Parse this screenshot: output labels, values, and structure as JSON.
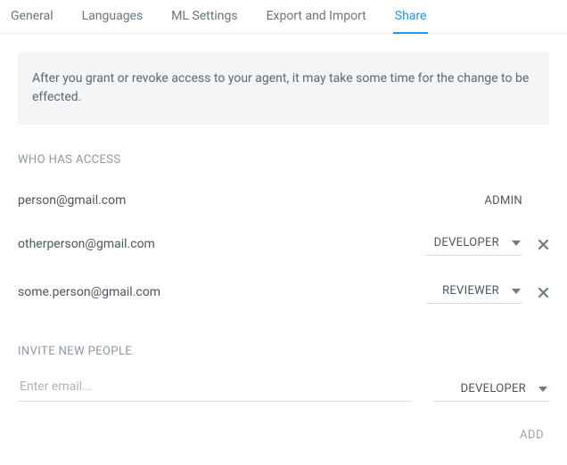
{
  "tabs": [
    {
      "label": "General",
      "active": false
    },
    {
      "label": "Languages",
      "active": false
    },
    {
      "label": "ML Settings",
      "active": false
    },
    {
      "label": "Export and Import",
      "active": false
    },
    {
      "label": "Share",
      "active": true
    }
  ],
  "notice": "After you grant or revoke access to your agent, it may take some time for the change to be effected.",
  "sections": {
    "access_heading": "WHO HAS ACCESS",
    "invite_heading": "INVITE NEW PEOPLE"
  },
  "access": [
    {
      "email": "person@gmail.com",
      "role": "ADMIN",
      "editable": false,
      "removable": false
    },
    {
      "email": "otherperson@gmail.com",
      "role": "DEVELOPER",
      "editable": true,
      "removable": true
    },
    {
      "email": "some.person@gmail.com",
      "role": "REVIEWER",
      "editable": true,
      "removable": true
    }
  ],
  "invite": {
    "placeholder": "Enter email...",
    "value": "",
    "role": "DEVELOPER",
    "add_label": "ADD"
  }
}
